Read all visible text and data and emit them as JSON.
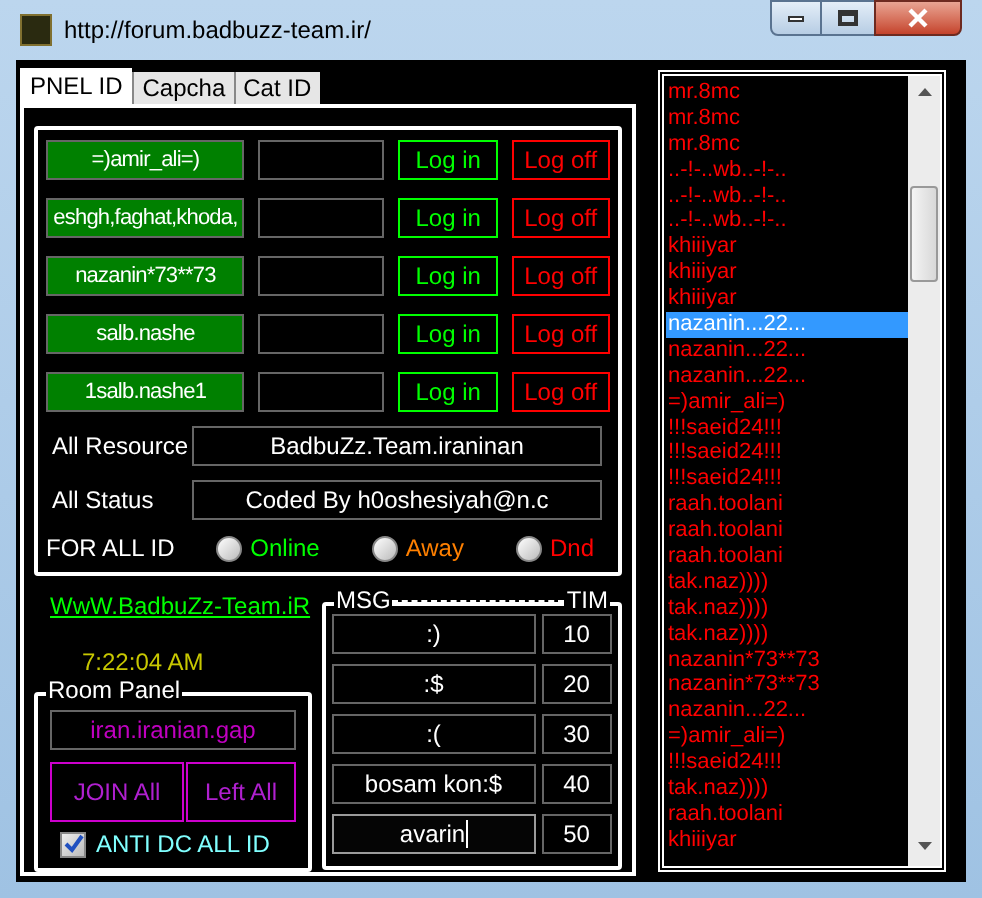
{
  "window": {
    "title": "http://forum.badbuzz-team.ir/"
  },
  "tabs": [
    {
      "label": "PNEL ID",
      "selected": true
    },
    {
      "label": "Capcha",
      "selected": false
    },
    {
      "label": "Cat ID",
      "selected": false
    }
  ],
  "accounts": [
    {
      "id": "=)amir_ali=)",
      "login": "Log in",
      "logoff": "Log off"
    },
    {
      "id": "eshgh,faghat,khoda,",
      "login": "Log in",
      "logoff": "Log off"
    },
    {
      "id": "nazanin*73**73",
      "login": "Log in",
      "logoff": "Log off"
    },
    {
      "id": "salb.nashe",
      "login": "Log in",
      "logoff": "Log off"
    },
    {
      "id": "1salb.nashe1",
      "login": "Log in",
      "logoff": "Log off"
    }
  ],
  "fields": [
    {
      "label": "All Resource",
      "value": "BadbuZz.Team.iraninan"
    },
    {
      "label": "All Status",
      "value": "Coded By h0oshesiyah@n.c"
    }
  ],
  "for_all": {
    "label": "FOR ALL ID",
    "options": [
      {
        "label": "Online",
        "color": "#00ff00",
        "selected": false
      },
      {
        "label": "Away",
        "color": "#ff8000",
        "selected": false
      },
      {
        "label": "Dnd",
        "color": "#ff0000",
        "selected": false
      }
    ]
  },
  "link": "WwW.BadbuZz-Team.iR",
  "clock": "7:22:04 AM",
  "room_panel": {
    "title": "Room Panel",
    "room": "iran.iranian.gap",
    "buttons": [
      "JOIN All",
      "Left All"
    ],
    "anti_dc": {
      "label": "ANTI DC ALL ID",
      "checked": true
    }
  },
  "messages": {
    "msg_title": "MSG",
    "tim_title": "TIM",
    "rows": [
      {
        "msg": ":)",
        "time": "10",
        "focused": false
      },
      {
        "msg": ":$",
        "time": "20",
        "focused": false
      },
      {
        "msg": ":(",
        "time": "30",
        "focused": false
      },
      {
        "msg": "bosam kon:$",
        "time": "40",
        "focused": false
      },
      {
        "msg": "avarin",
        "time": "50",
        "focused": true
      }
    ]
  },
  "users": [
    {
      "name": "mr.8mc",
      "selected": false
    },
    {
      "name": "mr.8mc",
      "selected": false
    },
    {
      "name": "mr.8mc",
      "selected": false
    },
    {
      "name": "..-!-..wb..-!-..",
      "selected": false
    },
    {
      "name": "..-!-..wb..-!-..",
      "selected": false
    },
    {
      "name": "..-!-..wb..-!-..",
      "selected": false
    },
    {
      "name": "khiiiyar",
      "selected": false
    },
    {
      "name": "khiiiyar",
      "selected": false
    },
    {
      "name": "khiiiyar",
      "selected": false
    },
    {
      "name": "nazanin...22...",
      "selected": true
    },
    {
      "name": "nazanin...22...",
      "selected": false
    },
    {
      "name": "nazanin...22...",
      "selected": false
    },
    {
      "name": "=)amir_ali=)",
      "selected": false
    },
    {
      "name": "!!!saeid24!!!",
      "selected": false
    },
    {
      "name": "!!!saeid24!!!",
      "selected": false
    },
    {
      "name": "!!!saeid24!!!",
      "selected": false
    },
    {
      "name": "raah.toolani",
      "selected": false
    },
    {
      "name": "raah.toolani",
      "selected": false
    },
    {
      "name": "raah.toolani",
      "selected": false
    },
    {
      "name": "tak.naz))))",
      "selected": false
    },
    {
      "name": "tak.naz))))",
      "selected": false
    },
    {
      "name": "tak.naz))))",
      "selected": false
    },
    {
      "name": "nazanin*73**73",
      "selected": false
    },
    {
      "name": "nazanin*73**73",
      "selected": false
    },
    {
      "name": "nazanin...22...",
      "selected": false
    },
    {
      "name": "=)amir_ali=)",
      "selected": false
    },
    {
      "name": "!!!saeid24!!!",
      "selected": false
    },
    {
      "name": "tak.naz))))",
      "selected": false
    },
    {
      "name": "raah.toolani",
      "selected": false
    },
    {
      "name": "khiiiyar",
      "selected": false
    }
  ]
}
